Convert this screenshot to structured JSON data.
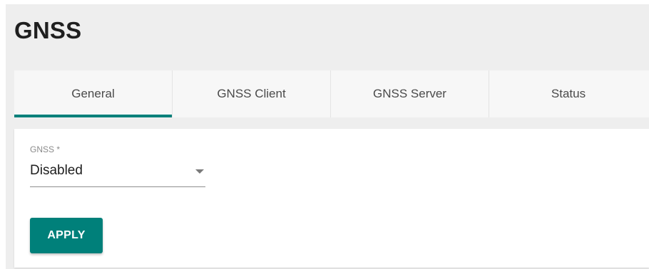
{
  "header": {
    "title": "GNSS"
  },
  "tabs": [
    {
      "label": "General",
      "active": true
    },
    {
      "label": "GNSS Client",
      "active": false
    },
    {
      "label": "GNSS Server",
      "active": false
    },
    {
      "label": "Status",
      "active": false
    }
  ],
  "form": {
    "gnss_label": "GNSS *",
    "gnss_value": "Disabled",
    "apply_label": "APPLY"
  },
  "colors": {
    "accent": "#00807a",
    "page_background": "#eeeeee",
    "card_background": "#ffffff"
  },
  "icons": {
    "dropdown": "chevron-down-icon"
  }
}
